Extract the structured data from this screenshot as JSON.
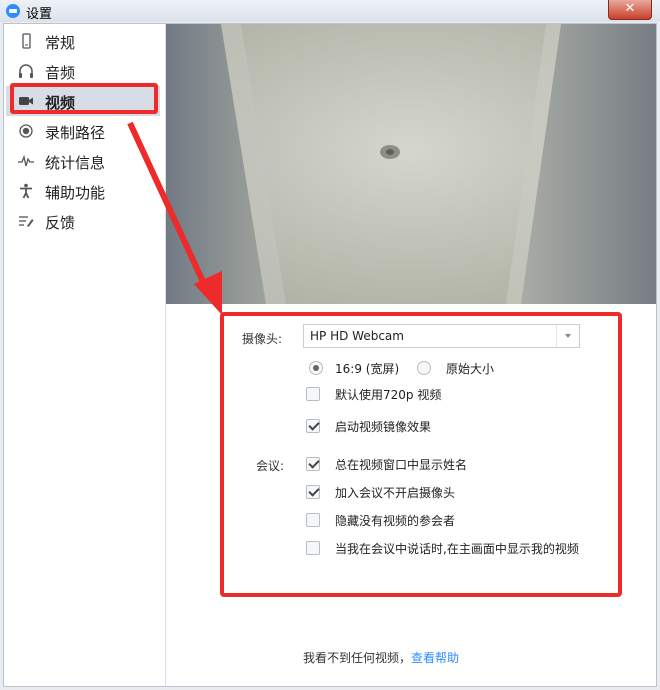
{
  "window": {
    "title": "设置",
    "close_glyph": "✕"
  },
  "sidebar": {
    "items": [
      {
        "label": "常规",
        "icon": "phone-icon",
        "active": false
      },
      {
        "label": "音频",
        "icon": "headphones-icon",
        "active": false
      },
      {
        "label": "视频",
        "icon": "video-camera-icon",
        "active": true
      },
      {
        "label": "录制路径",
        "icon": "record-icon",
        "active": false
      },
      {
        "label": "统计信息",
        "icon": "pulse-icon",
        "active": false
      },
      {
        "label": "辅助功能",
        "icon": "accessibility-icon",
        "active": false
      },
      {
        "label": "反馈",
        "icon": "feedback-icon",
        "active": false
      }
    ]
  },
  "video": {
    "camera_label": "摄像头:",
    "camera_value": "HP HD Webcam",
    "ratio_wide": "16:9 (宽屏)",
    "ratio_wide_selected": true,
    "ratio_original": "原始大小",
    "ratio_original_selected": false,
    "hd_default": {
      "label": "默认使用720p 视频",
      "checked": false
    },
    "mirror": {
      "label": "启动视频镜像效果",
      "checked": true
    },
    "meeting_label": "会议:",
    "meeting_options": [
      {
        "label": "总在视频窗口中显示姓名",
        "checked": true
      },
      {
        "label": "加入会议不开启摄像头",
        "checked": true
      },
      {
        "label": "隐藏没有视频的参会者",
        "checked": false
      },
      {
        "label": "当我在会议中说话时,在主画面中显示我的视频",
        "checked": false
      }
    ]
  },
  "footer": {
    "help_text": "我看不到任何视频，",
    "help_link": "查看帮助"
  },
  "colors": {
    "accent": "#2d8cff",
    "annotation": "#ee2a2a"
  }
}
